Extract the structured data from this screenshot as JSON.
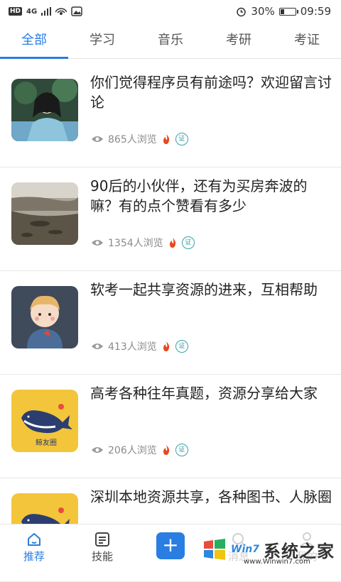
{
  "status_bar": {
    "network_chip": "HD",
    "signal": "4G",
    "battery": "30%",
    "battery_level": 0.3,
    "time": "09:59"
  },
  "tabs": [
    {
      "label": "全部",
      "active": true
    },
    {
      "label": "学习",
      "active": false
    },
    {
      "label": "音乐",
      "active": false
    },
    {
      "label": "考研",
      "active": false
    },
    {
      "label": "考证",
      "active": false
    }
  ],
  "posts": [
    {
      "title": "你们觉得程序员有前途吗？欢迎留言讨论",
      "views": "865人浏览",
      "thumb": "portrait-photo"
    },
    {
      "title": "90后的小伙伴，还有为买房奔波的嘛？有的点个赞看有多少",
      "views": "1354人浏览",
      "thumb": "river-photo"
    },
    {
      "title": "软考一起共享资源的进来，互相帮助",
      "views": "413人浏览",
      "thumb": "cartoon-boy"
    },
    {
      "title": "高考各种往年真题，资源分享给大家",
      "views": "206人浏览",
      "thumb": "whale-logo",
      "thumb_text": "鲸友圈"
    },
    {
      "title": "深圳本地资源共享，各种图书、人脉圈",
      "views": "",
      "thumb": "whale-logo"
    }
  ],
  "bottom_nav": {
    "items": [
      {
        "label": "推荐",
        "active": true
      },
      {
        "label": "技能",
        "active": false
      },
      {
        "label": "+",
        "active": false
      },
      {
        "label": "消息",
        "active": false
      },
      {
        "label": "我的",
        "active": false
      }
    ]
  },
  "watermark": {
    "text": "系统之家",
    "sub": "www.Winwin7.com",
    "brand": "Win7"
  },
  "colors": {
    "accent": "#2a7de1",
    "fire": "#e8481c",
    "cert": "#3aa0a6",
    "whale_bg": "#f3c53a"
  }
}
